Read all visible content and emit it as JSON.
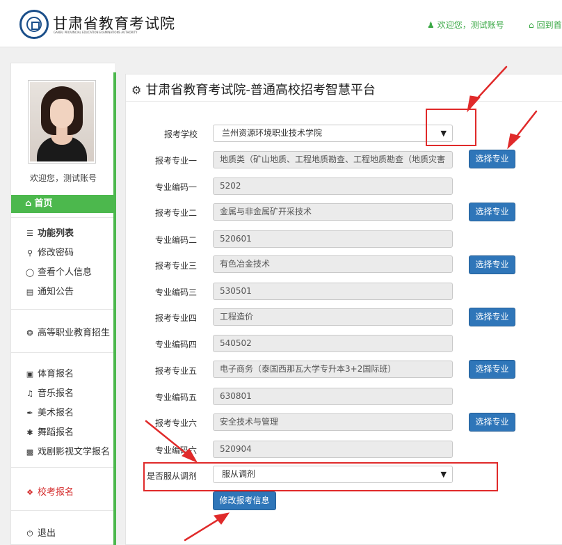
{
  "header": {
    "title": "甘肃省教育考试院",
    "subtitle": "GANSU PROVINCIAL EDUCATION EXAMINATIONS AUTHORITY",
    "welcome": "欢迎您，测试账号",
    "home_link": "回到首"
  },
  "sidebar": {
    "welcome": "欢迎您，测试账号",
    "home": "首页",
    "function_list": "功能列表",
    "change_password": "修改密码",
    "view_profile": "查看个人信息",
    "notices": "通知公告",
    "higher_vocational": "高等职业教育招生",
    "sports": "体育报名",
    "music": "音乐报名",
    "art": "美术报名",
    "dance": "舞蹈报名",
    "drama": "戏剧影视文学报名",
    "school_exam": "校考报名",
    "logout": "退出"
  },
  "panel": {
    "title": "甘肃省教育考试院-普通高校招考智慧平台"
  },
  "form": {
    "school_label": "报考学校",
    "school_value": "兰州资源环境职业技术学院",
    "major1_label": "报考专业一",
    "major1_value": "地质类（矿山地质、工程地质勘查、工程地质勘查（地质灾害",
    "code1_label": "专业编码一",
    "code1_value": "5202",
    "major2_label": "报考专业二",
    "major2_value": "金属与非金属矿开采技术",
    "code2_label": "专业编码二",
    "code2_value": "520601",
    "major3_label": "报考专业三",
    "major3_value": "有色冶金技术",
    "code3_label": "专业编码三",
    "code3_value": "530501",
    "major4_label": "报考专业四",
    "major4_value": "工程造价",
    "code4_label": "专业编码四",
    "code4_value": "540502",
    "major5_label": "报考专业五",
    "major5_value": "电子商务（泰国西那瓦大学专升本3+2国际班）",
    "code5_label": "专业编码五",
    "code5_value": "630801",
    "major6_label": "报考专业六",
    "major6_value": "安全技术与管理",
    "code6_label": "专业编码六",
    "code6_value": "520904",
    "adjust_label": "是否服从调剂",
    "adjust_value": "服从调剂",
    "pick_button": "选择专业",
    "submit_button": "修改报考信息"
  },
  "icons": {
    "user": "user-icon",
    "home": "home-icon",
    "gear": "gear-icon"
  },
  "colors": {
    "accent_green": "#4cb84d",
    "button_blue": "#2f76b9",
    "annotation_red": "#e02a2a"
  }
}
